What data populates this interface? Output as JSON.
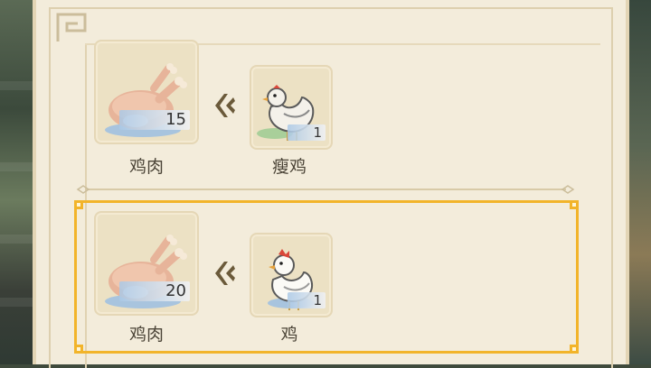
{
  "recipes": [
    {
      "output": {
        "icon": "roast-chicken-icon",
        "count": "15",
        "name": "鸡肉"
      },
      "input": {
        "icon": "thin-chicken-icon",
        "count": "1",
        "name": "瘦鸡"
      },
      "selected": false
    },
    {
      "output": {
        "icon": "roast-chicken-icon",
        "count": "20",
        "name": "鸡肉"
      },
      "input": {
        "icon": "chicken-icon",
        "count": "1",
        "name": "鸡"
      },
      "selected": true
    }
  ],
  "colors": {
    "panel": "#f3ecdb",
    "tile": "#ece1c4",
    "selection": "#f2b42a",
    "arrow": "#6b5a3a"
  }
}
